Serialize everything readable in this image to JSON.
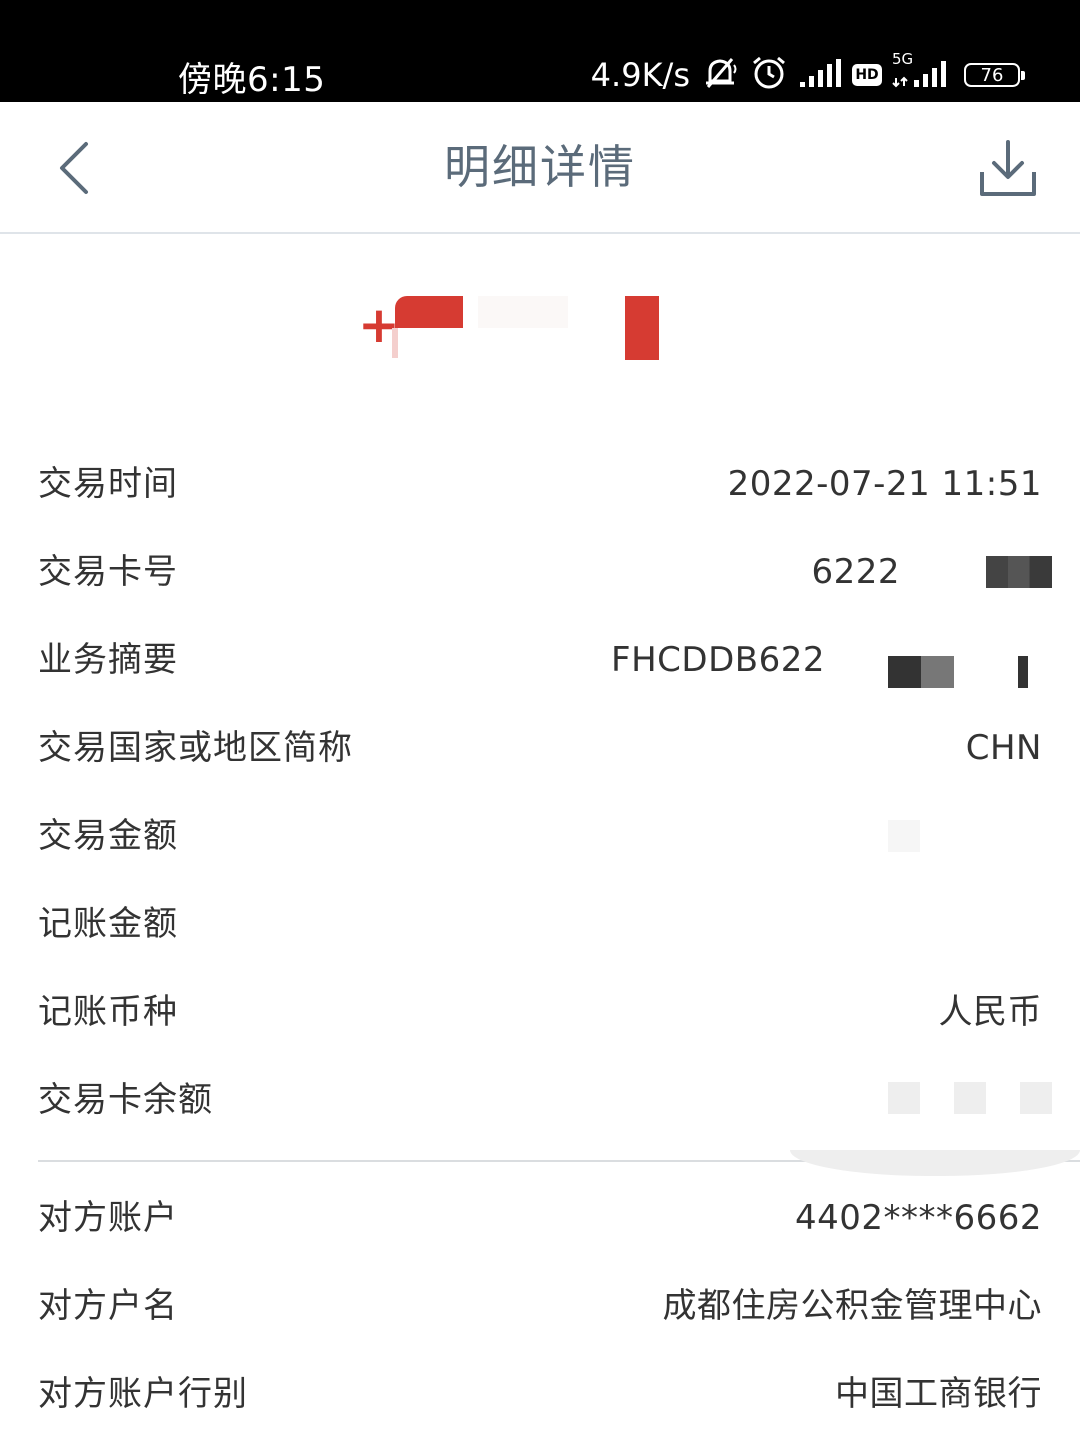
{
  "status_bar": {
    "time": "傍晚6:15",
    "speed": "4.9K/s",
    "network": "5G",
    "hd": "HD",
    "battery": "76"
  },
  "nav": {
    "title": "明细详情"
  },
  "amount": {
    "sign": "+"
  },
  "details": [
    {
      "label": "交易时间",
      "value": "2022-07-21 11:51"
    },
    {
      "label": "交易卡号",
      "value": "6222"
    },
    {
      "label": "业务摘要",
      "value": "FHCDDB622"
    },
    {
      "label": "交易国家或地区简称",
      "value": "CHN"
    },
    {
      "label": "交易金额",
      "value": ""
    },
    {
      "label": "记账金额",
      "value": ""
    },
    {
      "label": "记账币种",
      "value": "人民币"
    },
    {
      "label": "交易卡余额",
      "value": ""
    }
  ],
  "counterparty": [
    {
      "label": "对方账户",
      "value": "4402****6662"
    },
    {
      "label": "对方户名",
      "value": "成都住房公积金管理中心"
    },
    {
      "label": "对方账户行别",
      "value": "中国工商银行"
    }
  ],
  "colors": {
    "accent_red": "#d63b32",
    "title_gray": "#5b6b7a",
    "text": "#333333",
    "divider": "#dadde0"
  }
}
